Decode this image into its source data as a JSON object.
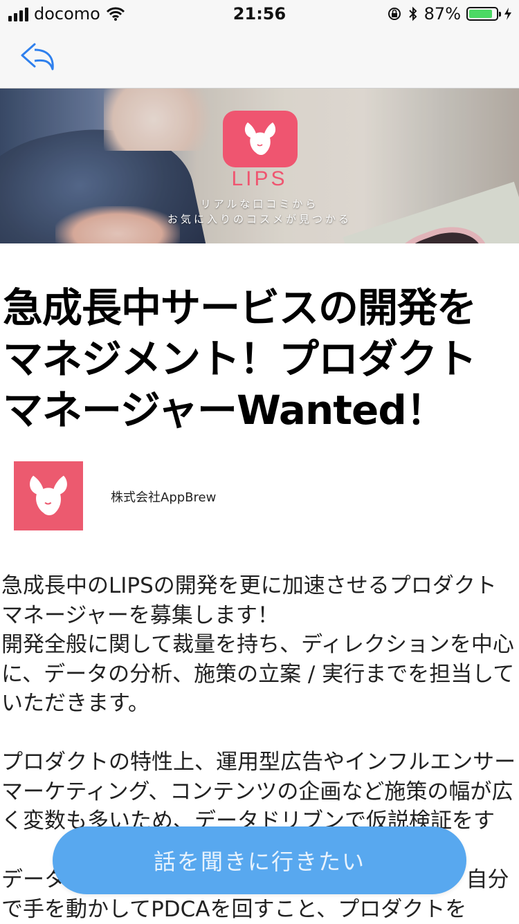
{
  "status_bar": {
    "carrier": "docomo",
    "time": "21:56",
    "battery_percent": "87%",
    "battery_level": 0.87
  },
  "nav": {
    "back_icon": "back-arrow-icon"
  },
  "hero": {
    "brand": "LIPS",
    "tagline_1": "リアルな口コミから",
    "tagline_2": "お気に入りのコスメが見つかる",
    "accent": "#ef5570"
  },
  "article": {
    "title": "急成長中サービスの開発をマネジメント！プロダクトマネージャーWanted！",
    "company_name": "株式会社AppBrew",
    "body": "急成長中のLIPSの開発を更に加速させるプロダクトマネージャーを募集します！\n開発全般に関して裁量を持ち、ディレクションを中心に、データの分析、施策の立案 / 実行までを担当していただきます。\n\nプロダクトの特性上、運用型広告やインフルエンサーマーケティング、コンテンツの企画など施策の幅が広く変数も多いため、データドリブンで仮説検証をす\n\nデータ分析・UI/UX改善のディレクションなど、自分で手を動かしてPDCAを回すこと、プロダクトを"
  },
  "cta": {
    "label": "話を聞きに行きたい",
    "color": "#58a8ef"
  }
}
